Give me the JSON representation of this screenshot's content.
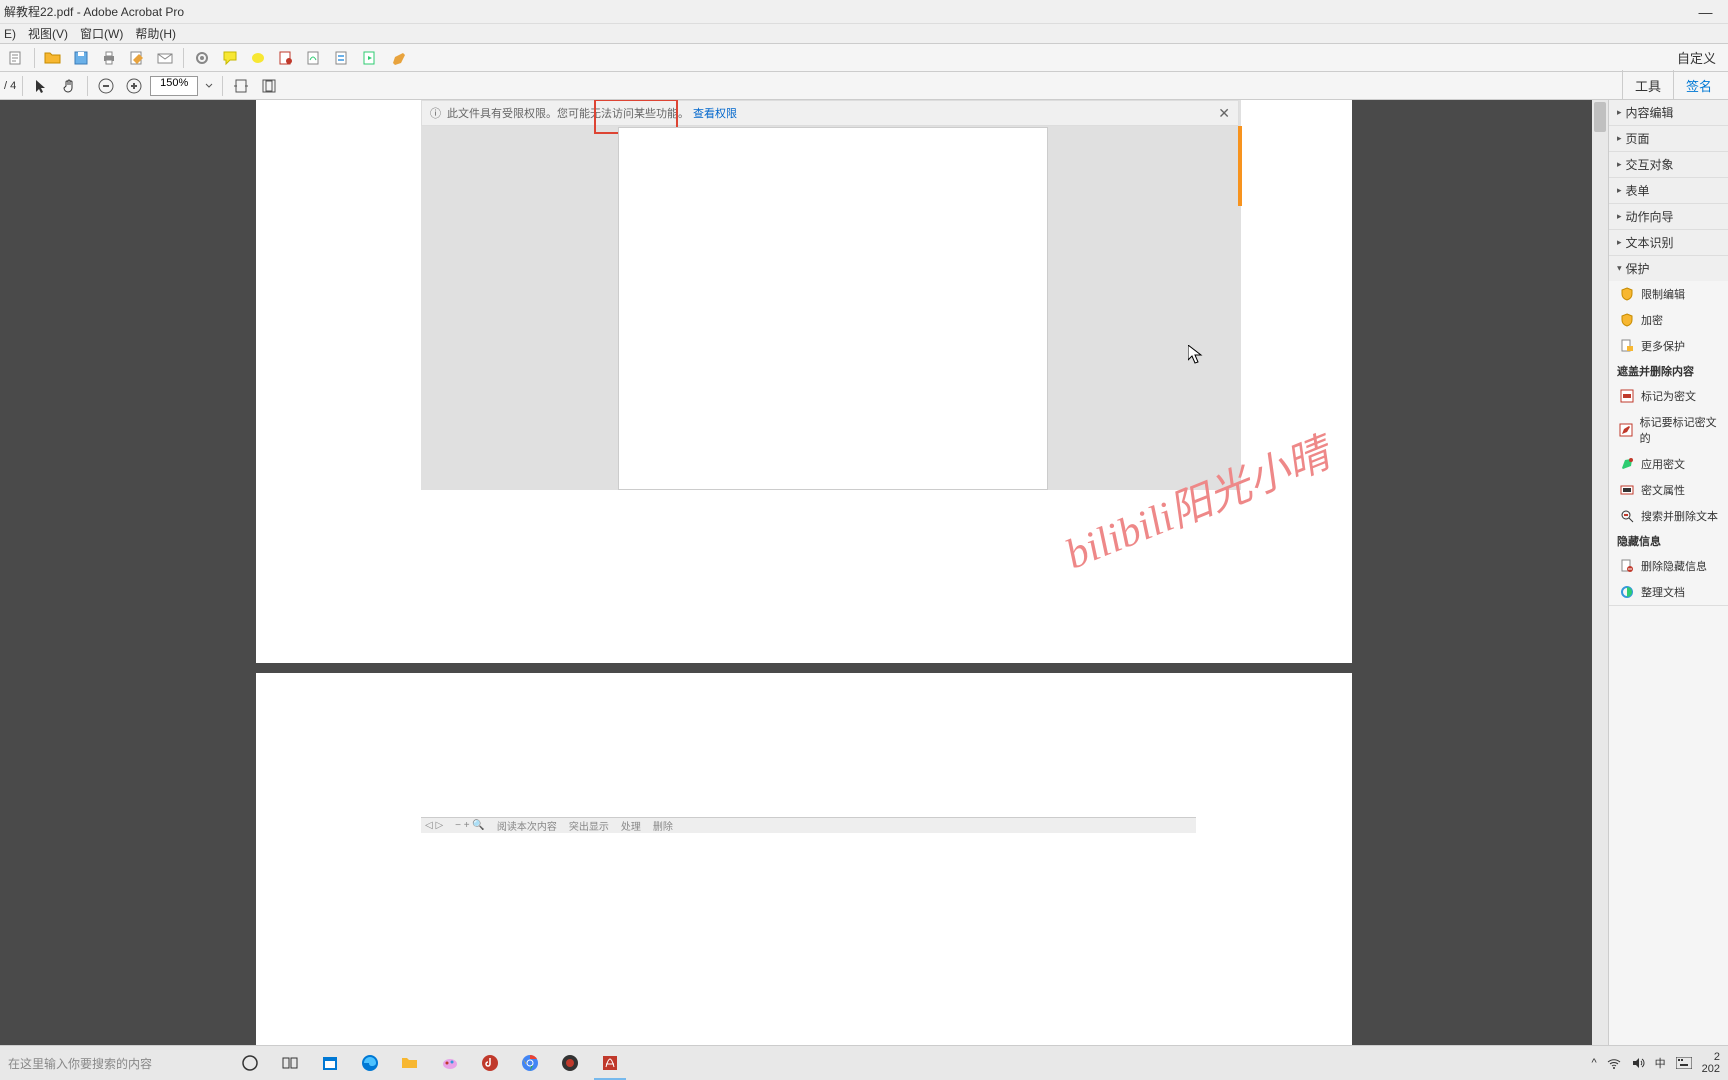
{
  "window": {
    "title": "解教程22.pdf - Adobe Acrobat Pro",
    "minimize": "—"
  },
  "menu": {
    "edit": "E)",
    "view": "视图(V)",
    "window": "窗口(W)",
    "help": "帮助(H)"
  },
  "toolbar": {
    "customize": "自定义"
  },
  "secondbar": {
    "page_sep": "/ 4",
    "zoom": "150%"
  },
  "right_tabs": {
    "tools": "工具",
    "sign": "签名"
  },
  "notification": {
    "text": "此文件具有受限权限。您可能无法访问某些功能。",
    "link": "查看权限",
    "close": "✕"
  },
  "watermark": "bilibili阳光小晴",
  "mini_toolbar": {
    "read_this": "阅读本次内容",
    "highlight": "突出显示",
    "other1": "处理",
    "other2": "删除"
  },
  "right_pane": {
    "sections": {
      "content_edit": "内容编辑",
      "pages": "页面",
      "interactive": "交互对象",
      "forms": "表单",
      "action_wizard": "动作向导",
      "text_recognition": "文本识别",
      "protect": "保护"
    },
    "protect_items": {
      "restrict_editing": "限制编辑",
      "encrypt": "加密",
      "more_protect": "更多保护"
    },
    "redact_header": "遮盖并删除内容",
    "redact_items": {
      "mark_redaction": "标记为密文",
      "mark_for_redaction": "标记要标记密文的",
      "apply_redaction": "应用密文",
      "redaction_props": "密文属性",
      "search_remove": "搜索并删除文本"
    },
    "hidden_header": "隐藏信息",
    "hidden_items": {
      "remove_hidden": "删除隐藏信息",
      "sanitize": "整理文档"
    }
  },
  "taskbar": {
    "search_placeholder": "在这里输入你要搜索的内容",
    "ime": "中",
    "time_partial": "2",
    "date_partial": "202"
  },
  "systray": {
    "chevron": "^"
  }
}
